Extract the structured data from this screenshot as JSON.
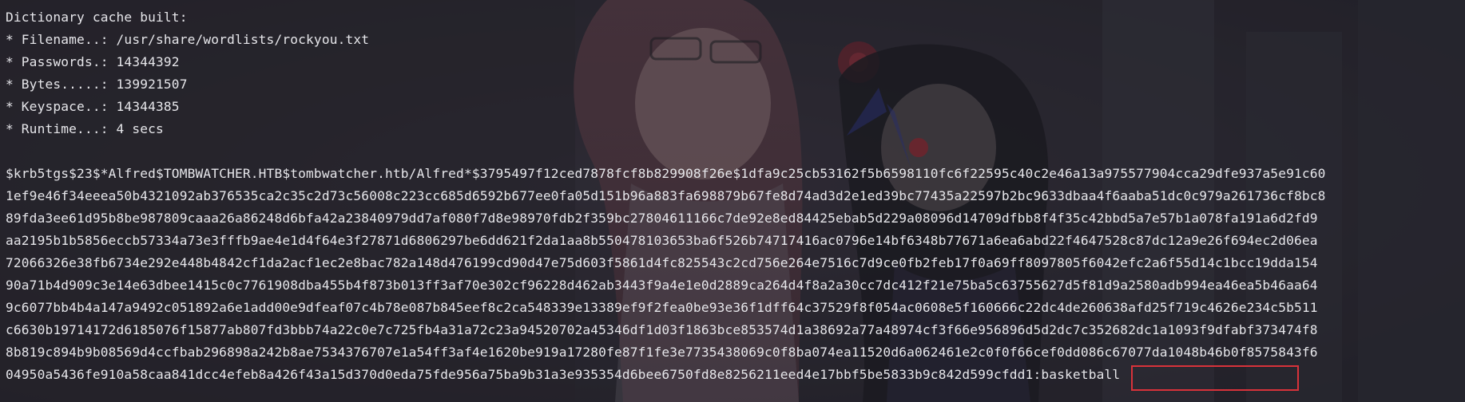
{
  "terminal": {
    "summary": [
      "Dictionary cache built:",
      "* Filename..: /usr/share/wordlists/rockyou.txt",
      "* Passwords.: 14344392",
      "* Bytes.....: 139921507",
      "* Keyspace..: 14344385",
      "* Runtime...: 4 secs"
    ],
    "hash_lines": [
      "$krb5tgs$23$*Alfred$TOMBWATCHER.HTB$tombwatcher.htb/Alfred*$3795497f12ced7878fcf8b829908f26e$1dfa9c25cb53162f5b6598110fc6f22595c40c2e46a13a975577904cca29dfe937a5e91c60",
      "1ef9e46f34eeea50b4321092ab376535ca2c35c2d73c56008c223cc685d6592b677ee0fa05d151b96a883fa698879b67fe8d74ad3d2e1ed39bc77435a22597b2bc9633dbaa4f6aaba51dc0c979a261736cf8bc8",
      "89fda3ee61d95b8be987809caaa26a86248d6bfa42a23840979dd7af080f7d8e98970fdb2f359bc27804611166c7de92e8ed84425ebab5d229a08096d14709dfbb8f4f35c42bbd5a7e57b1a078fa191a6d2fd9",
      "aa2195b1b5856eccb57334a73e3fffb9ae4e1d4f64e3f27871d6806297be6dd621f2da1aa8b550478103653ba6f526b74717416ac0796e14bf6348b77671a6ea6abd22f4647528c87dc12a9e26f694ec2d06ea",
      "72066326e38fb6734e292e448b4842cf1da2acf1ec2e8bac782a148d476199cd90d47e75d603f5861d4fc825543c2cd756e264e7516c7d9ce0fb2feb17f0a69ff8097805f6042efc2a6f55d14c1bcc19dda154",
      "90a71b4d909c3e14e63dbee1415c0c7761908dba455b4f873b013ff3af70e302cf96228d462ab3443f9a4e1e0d2889ca264d4f8a2a30cc7dc412f21e75ba5c63755627d5f81d9a2580adb994ea46ea5b46aa64",
      "9c6077bb4b4a147a9492c051892a6e1add00e9dfeaf07c4b78e087b845eef8c2ca548339e13389ef9f2fea0be93e36f1dff64c37529f8f054ac0608e5f160666c22dc4de260638afd25f719c4626e234c5b511",
      "c6630b19714172d6185076f15877ab807fd3bbb74a22c0e7c725fb4a31a72c23a94520702a45346df1d03f1863bce853574d1a38692a77a48974cf3f66e956896d5d2dc7c352682dc1a1093f9dfabf373474f8",
      "8b819c894b9b08569d4ccfbab296898a242b8ae7534376707e1a54ff3af4e1620be919a17280fe87f1fe3e7735438069c0f8ba074ea11520d6a062461e2c0f0f66cef0dd086c67077da1048b46b0f8575843f6",
      "04950a5436fe910a58caa841dcc4efeb8a426f43a15d370d0eda75fde956a75ba9b31a3e935354d6bee6750fd8e8256211eed4e17bbf5be5833b9c842d599cfdd1:basketball"
    ]
  }
}
